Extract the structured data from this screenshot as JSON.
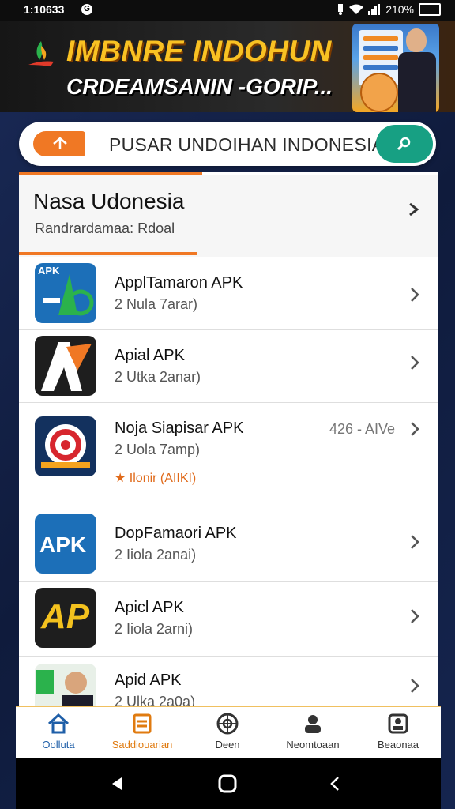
{
  "status_bar": {
    "time": "1:10633",
    "notif_glyph": "G",
    "battery": "210%"
  },
  "banner": {
    "title": "IMBNRE INDOHUN",
    "subtitle": "CRDEAMSANIN -GORIP..."
  },
  "search": {
    "placeholder": "PUSAR UNDOIHAN INDONESIA"
  },
  "section": {
    "title": "Nasa Udonesia",
    "subtitle": "Randrardamaa: Rdoal"
  },
  "apps": [
    {
      "name": "ApplTamaron APK",
      "meta": "2 Nula 7arar)",
      "icon_text": "APK"
    },
    {
      "name": "Apial APK",
      "meta": "2 Utka 2anar)",
      "icon_text": "A"
    },
    {
      "name": "Noja Siapisar APK",
      "meta": "2 Uola 7amp)",
      "extra": "426 - AIVe",
      "tag": "Ilonir (AIIKI)",
      "icon_text": ""
    },
    {
      "name": "DopFamaori APK",
      "meta": "2 Iiola 2anai)",
      "icon_text": "APK"
    },
    {
      "name": "Apicl APK",
      "meta": "2 Iiola 2arni)",
      "icon_text": "AP"
    },
    {
      "name": "Apid APK",
      "meta": "2 Ulka 2a0a)",
      "icon_text": ""
    }
  ],
  "nav": [
    {
      "label": "Oolluta"
    },
    {
      "label": "Saddiouarian"
    },
    {
      "label": "Deen"
    },
    {
      "label": "Neomtoaan"
    },
    {
      "label": "Beaonaa"
    }
  ],
  "colors": {
    "accent": "#f07824",
    "search_button": "#17a083",
    "banner_title": "#f9c223"
  }
}
